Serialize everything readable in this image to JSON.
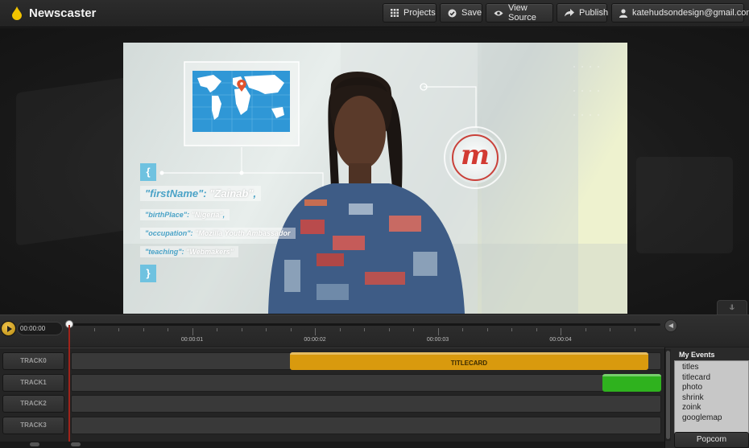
{
  "header": {
    "app_title": "Newscaster",
    "buttons": {
      "projects": "Projects",
      "save": "Save",
      "view_source": "View Source",
      "publish": "Publish",
      "account": "katehudsondesign@gmail.com"
    }
  },
  "video": {
    "json_open": "{",
    "json_close": "}",
    "fields": [
      {
        "key": "\"firstName\"",
        "sep": ": ",
        "value": "\"Zainab\"",
        "tail": ","
      },
      {
        "key": "\"birthPlace\"",
        "sep": ": ",
        "value": "\"Nigeria\"",
        "tail": ","
      },
      {
        "key": "\"occupation\"",
        "sep": ": ",
        "value": "\"Mozilla Youth Ambassador",
        "tail": ""
      },
      {
        "key": "\"teaching\"",
        "sep": ": ",
        "value": "\"Webmakers\"",
        "tail": ""
      }
    ],
    "badge_letter": "m"
  },
  "transport": {
    "timecode": "00:00:00",
    "collapse_icon": "⥥",
    "ruler_labels": [
      "00:00:01",
      "00:00:02",
      "00:00:03",
      "00:00:04"
    ]
  },
  "tracks": [
    {
      "label": "TRACK0",
      "event": {
        "label": "TITLECARD",
        "color": "#d99a0e",
        "start": 0.371,
        "end": 0.978
      }
    },
    {
      "label": "TRACK1",
      "event": {
        "label": "",
        "color": "#2fb21e",
        "start": 0.901,
        "end": 1.0
      }
    },
    {
      "label": "TRACK2",
      "event": null
    },
    {
      "label": "TRACK3",
      "event": null
    }
  ],
  "events_panel": {
    "title": "My Events",
    "items": [
      "titles",
      "titlecard",
      "photo",
      "shrink",
      "zoink",
      "googlemap"
    ],
    "popcorn_label": "Popcorn"
  },
  "colors": {
    "accent": "#d99a0e",
    "playhead": "#a0231a",
    "logo_drop": "#f2c400",
    "map_pin": "#e2532d"
  },
  "icons": [
    "flame-logo-icon",
    "grid-icon",
    "check-circle-icon",
    "eye-icon",
    "share-arrow-icon",
    "user-icon",
    "play-icon",
    "volume-icon",
    "chevron-down-icon"
  ]
}
